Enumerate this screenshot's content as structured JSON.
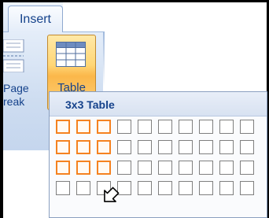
{
  "ribbon": {
    "tab_label": "Insert",
    "page_break_label": "Page\nreak",
    "table_button_label": "Table",
    "table_arrow": "▾"
  },
  "table_dropdown": {
    "title": "3x3 Table",
    "grid_columns": 10,
    "grid_rows": 4,
    "selected_columns": 3,
    "selected_rows": 3
  }
}
